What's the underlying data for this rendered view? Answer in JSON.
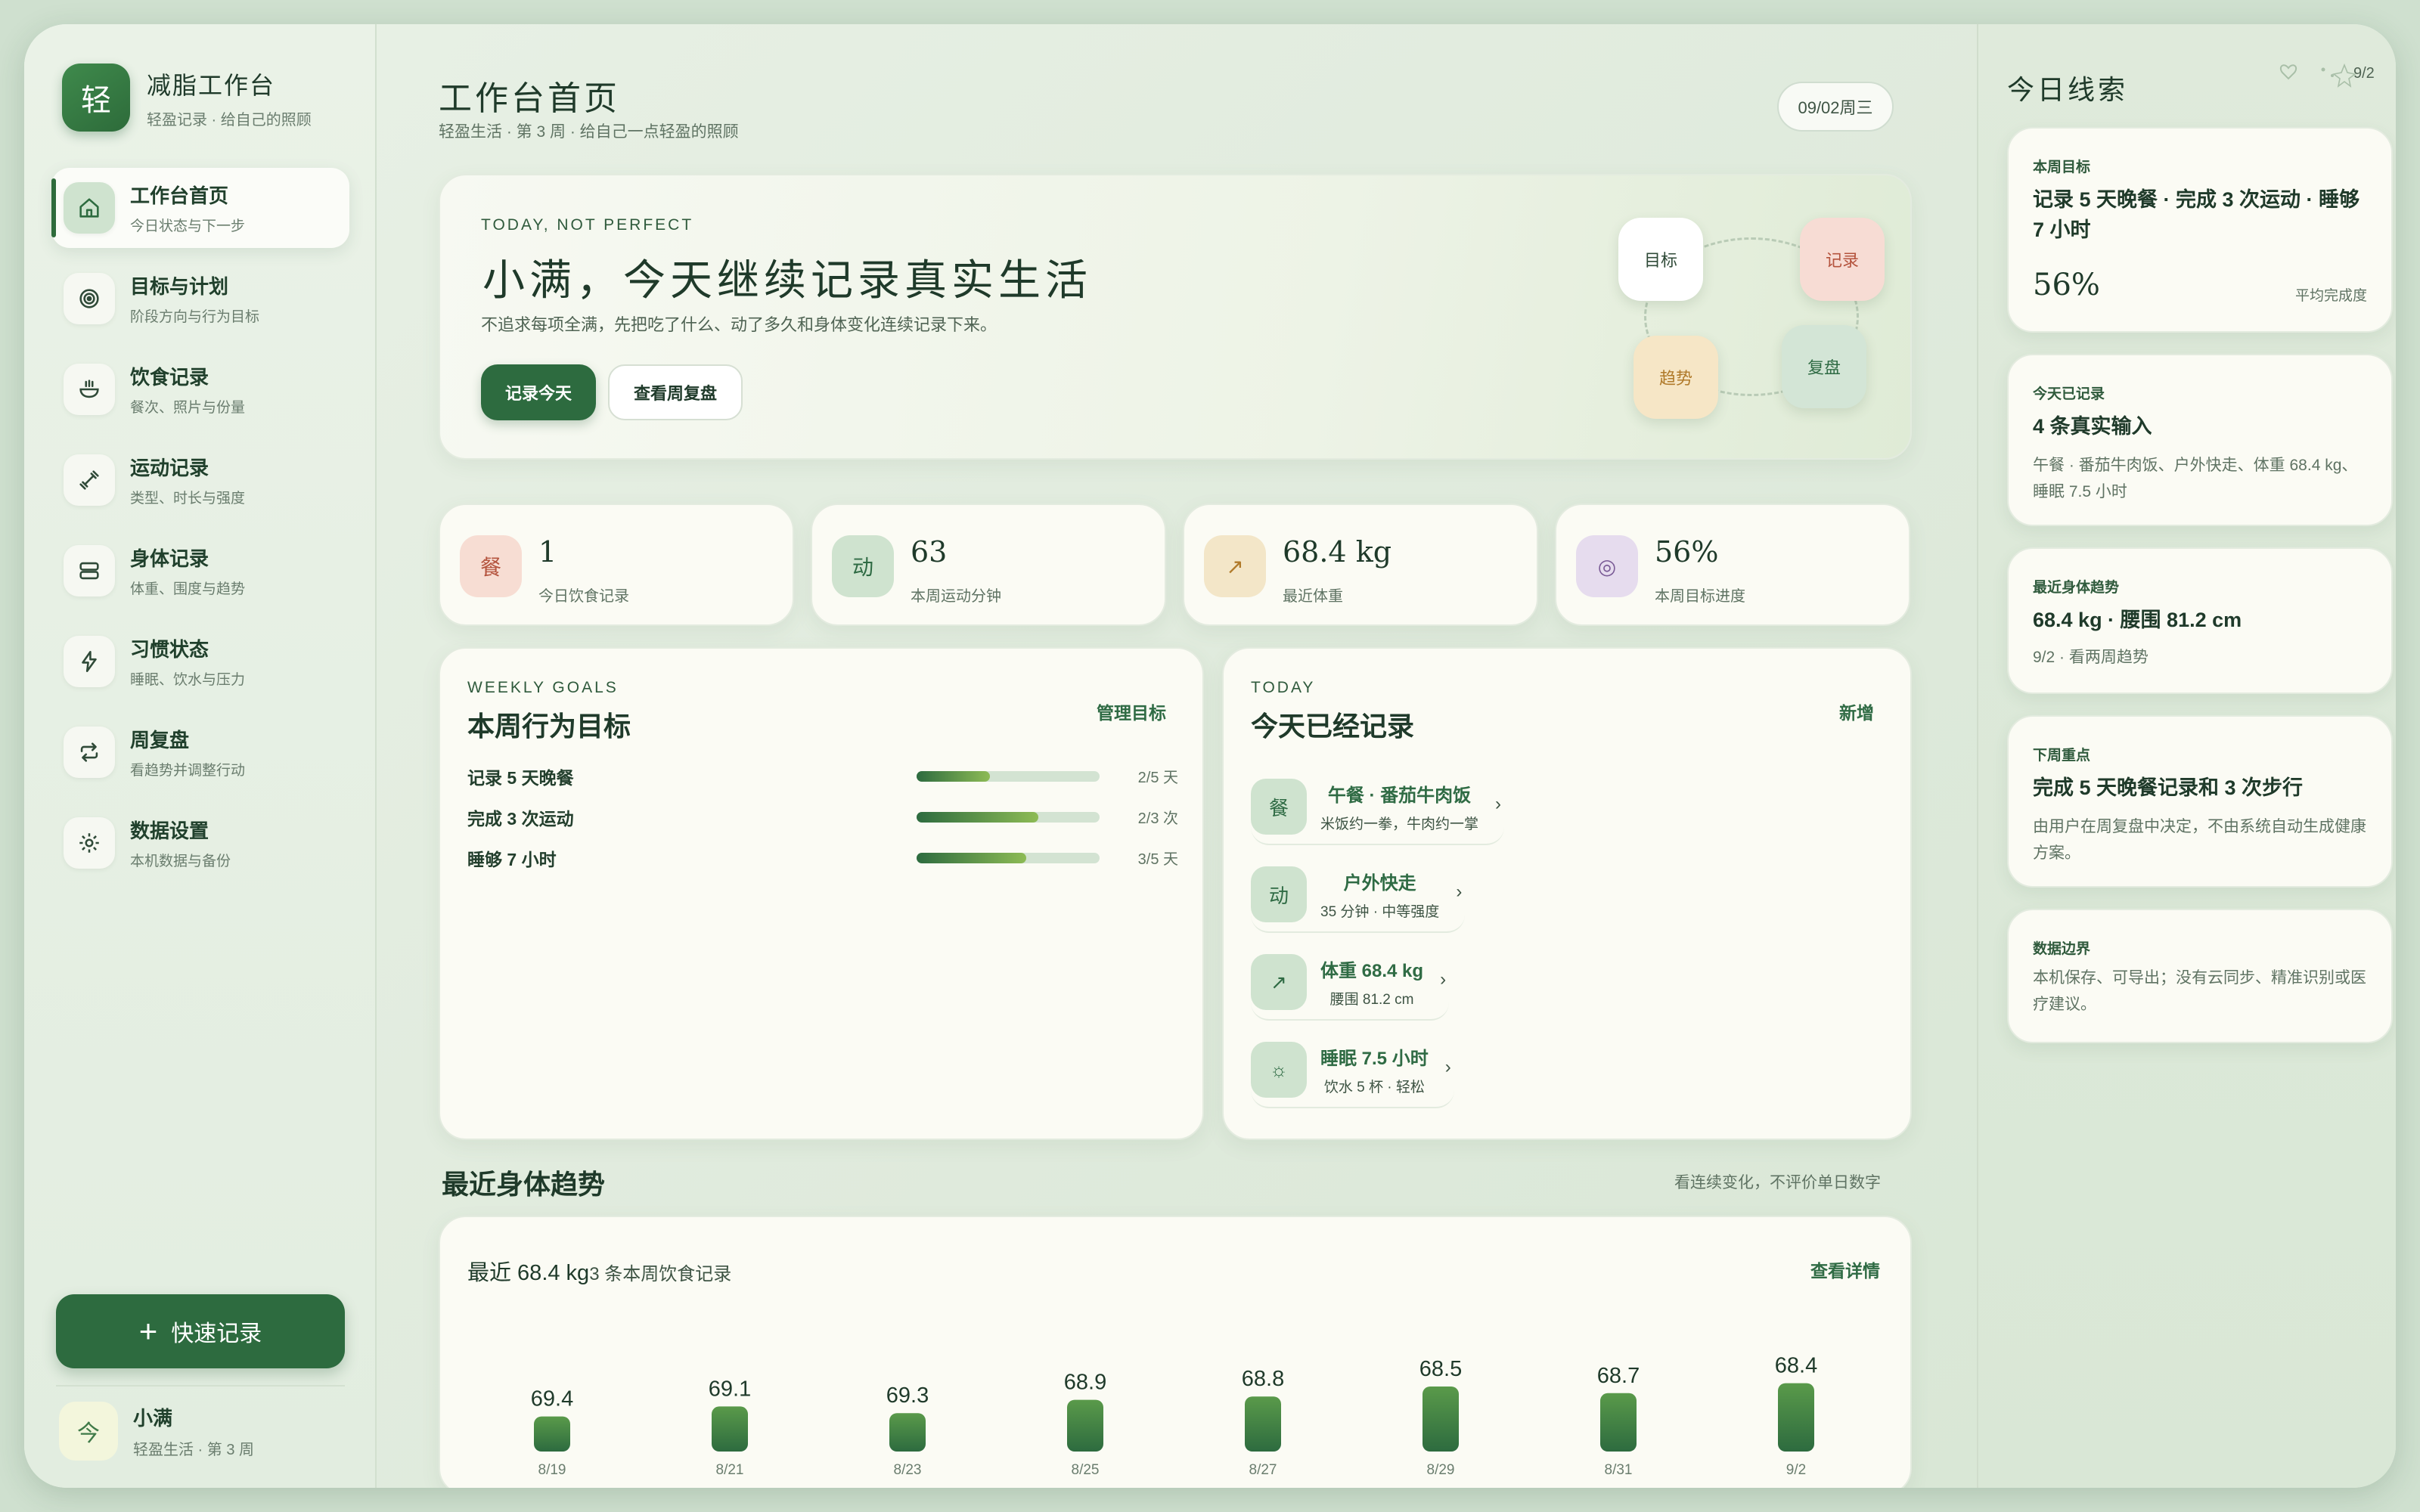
{
  "brand": {
    "logo_char": "轻",
    "title": "减脂工作台",
    "subtitle": "轻盈记录 · 给自己的照顾"
  },
  "nav": [
    {
      "title": "工作台首页",
      "sub": "今日状态与下一步",
      "icon": "home-icon"
    },
    {
      "title": "目标与计划",
      "sub": "阶段方向与行为目标",
      "icon": "target-icon"
    },
    {
      "title": "饮食记录",
      "sub": "餐次、照片与份量",
      "icon": "bowl-icon"
    },
    {
      "title": "运动记录",
      "sub": "类型、时长与强度",
      "icon": "dumbbell-icon"
    },
    {
      "title": "身体记录",
      "sub": "体重、围度与趋势",
      "icon": "scale-icon"
    },
    {
      "title": "习惯状态",
      "sub": "睡眠、饮水与压力",
      "icon": "lightning-icon"
    },
    {
      "title": "周复盘",
      "sub": "看趋势并调整行动",
      "icon": "repeat-icon"
    },
    {
      "title": "数据设置",
      "sub": "本机数据与备份",
      "icon": "gear-icon"
    }
  ],
  "quick_record": {
    "plus": "+",
    "label": "快速记录"
  },
  "user": {
    "avatar_char": "今",
    "name": "小满",
    "sub": "轻盈生活 · 第 3 周"
  },
  "header": {
    "title": "工作台首页",
    "subtitle": "轻盈生活 · 第 3 周 · 给自己一点轻盈的照顾",
    "date": "09/02周三"
  },
  "hero": {
    "kicker": "TODAY, NOT PERFECT",
    "title": "小满，今天继续记录真实生活",
    "desc": "不追求每项全满，先把吃了什么、动了多久和身体变化连续记录下来。",
    "primary_btn": "记录今天",
    "secondary_btn": "查看周复盘",
    "cycle": {
      "goal": "目标",
      "record": "记录",
      "trend": "趋势",
      "review": "复盘"
    }
  },
  "stats": [
    {
      "icon_char": "餐",
      "value": "1",
      "label": "今日饮食记录",
      "bg": "#f7ddd3",
      "fg": "#b4533d"
    },
    {
      "icon_char": "动",
      "value": "63",
      "label": "本周运动分钟",
      "bg": "#cfe3cf",
      "fg": "#2f6b44"
    },
    {
      "icon_char": "↗",
      "value": "68.4 kg",
      "label": "最近体重",
      "bg": "#f3e6c8",
      "fg": "#b07a2a"
    },
    {
      "icon_char": "◎",
      "value": "56%",
      "label": "本周目标进度",
      "bg": "#e6dcee",
      "fg": "#7a5a96"
    }
  ],
  "weekly_goals": {
    "kicker": "WEEKLY GOALS",
    "title": "本周行为目标",
    "link": "管理目标",
    "items": [
      {
        "name": "记录 5 天晚餐",
        "count": "2/5 天",
        "progress": 0.4
      },
      {
        "name": "完成 3 次运动",
        "count": "2/3 次",
        "progress": 0.667
      },
      {
        "name": "睡够 7 小时",
        "count": "3/5 天",
        "progress": 0.6
      }
    ]
  },
  "today": {
    "kicker": "TODAY",
    "title": "今天已经记录",
    "link": "新增",
    "chevron": "›",
    "items": [
      {
        "icon_char": "餐",
        "title": "午餐 · 番茄牛肉饭",
        "sub": "米饭约一拳，牛肉约一掌"
      },
      {
        "icon_char": "动",
        "title": "户外快走",
        "sub": "35 分钟 · 中等强度"
      },
      {
        "icon_char": "↗",
        "title": "体重 68.4 kg",
        "sub": "腰围 81.2 cm"
      },
      {
        "icon_char": "☼",
        "title": "睡眠 7.5 小时",
        "sub": "饮水 5 杯 · 轻松"
      }
    ]
  },
  "trend": {
    "heading": "最近身体趋势",
    "note": "看连续变化，不评价单日数字",
    "summary_main": "最近 68.4 kg",
    "summary_sub": "3 条本周饮食记录",
    "link": "查看详情"
  },
  "chart_data": {
    "type": "bar",
    "categories": [
      "8/19",
      "8/21",
      "8/23",
      "8/25",
      "8/27",
      "8/29",
      "8/31",
      "9/2"
    ],
    "values": [
      69.4,
      69.1,
      69.3,
      68.9,
      68.8,
      68.5,
      68.7,
      68.4
    ],
    "title": "",
    "xlabel": "",
    "ylabel": "",
    "grid": false,
    "colors": {
      "bar_top": "#5a9a4a",
      "bar_bottom": "#2d6b3f"
    }
  },
  "right_panel": {
    "title": "今日线索",
    "badge": "9/2",
    "cards": [
      {
        "kicker": "本周目标",
        "main": "记录 5 天晚餐 · 完成 3 次运动 · 睡够 7 小时",
        "value": "56%",
        "value_label": "平均完成度"
      },
      {
        "kicker": "今天已记录",
        "main": "4 条真实输入",
        "desc": "午餐 · 番茄牛肉饭、户外快走、体重 68.4 kg、睡眠 7.5 小时"
      },
      {
        "kicker": "最近身体趋势",
        "main": "68.4 kg · 腰围 81.2 cm",
        "desc": "9/2 · 看两周趋势"
      },
      {
        "kicker": "下周重点",
        "main": "完成 5 天晚餐记录和 3 次步行",
        "desc": "由用户在周复盘中决定，不由系统自动生成健康方案。"
      },
      {
        "kicker": "数据边界",
        "desc": "本机保存、可导出；没有云同步、精准识别或医疗建议。"
      }
    ]
  },
  "colors": {
    "accent": "#2d6b3f",
    "background": "#e4eee1",
    "card": "#fbfbf4"
  }
}
